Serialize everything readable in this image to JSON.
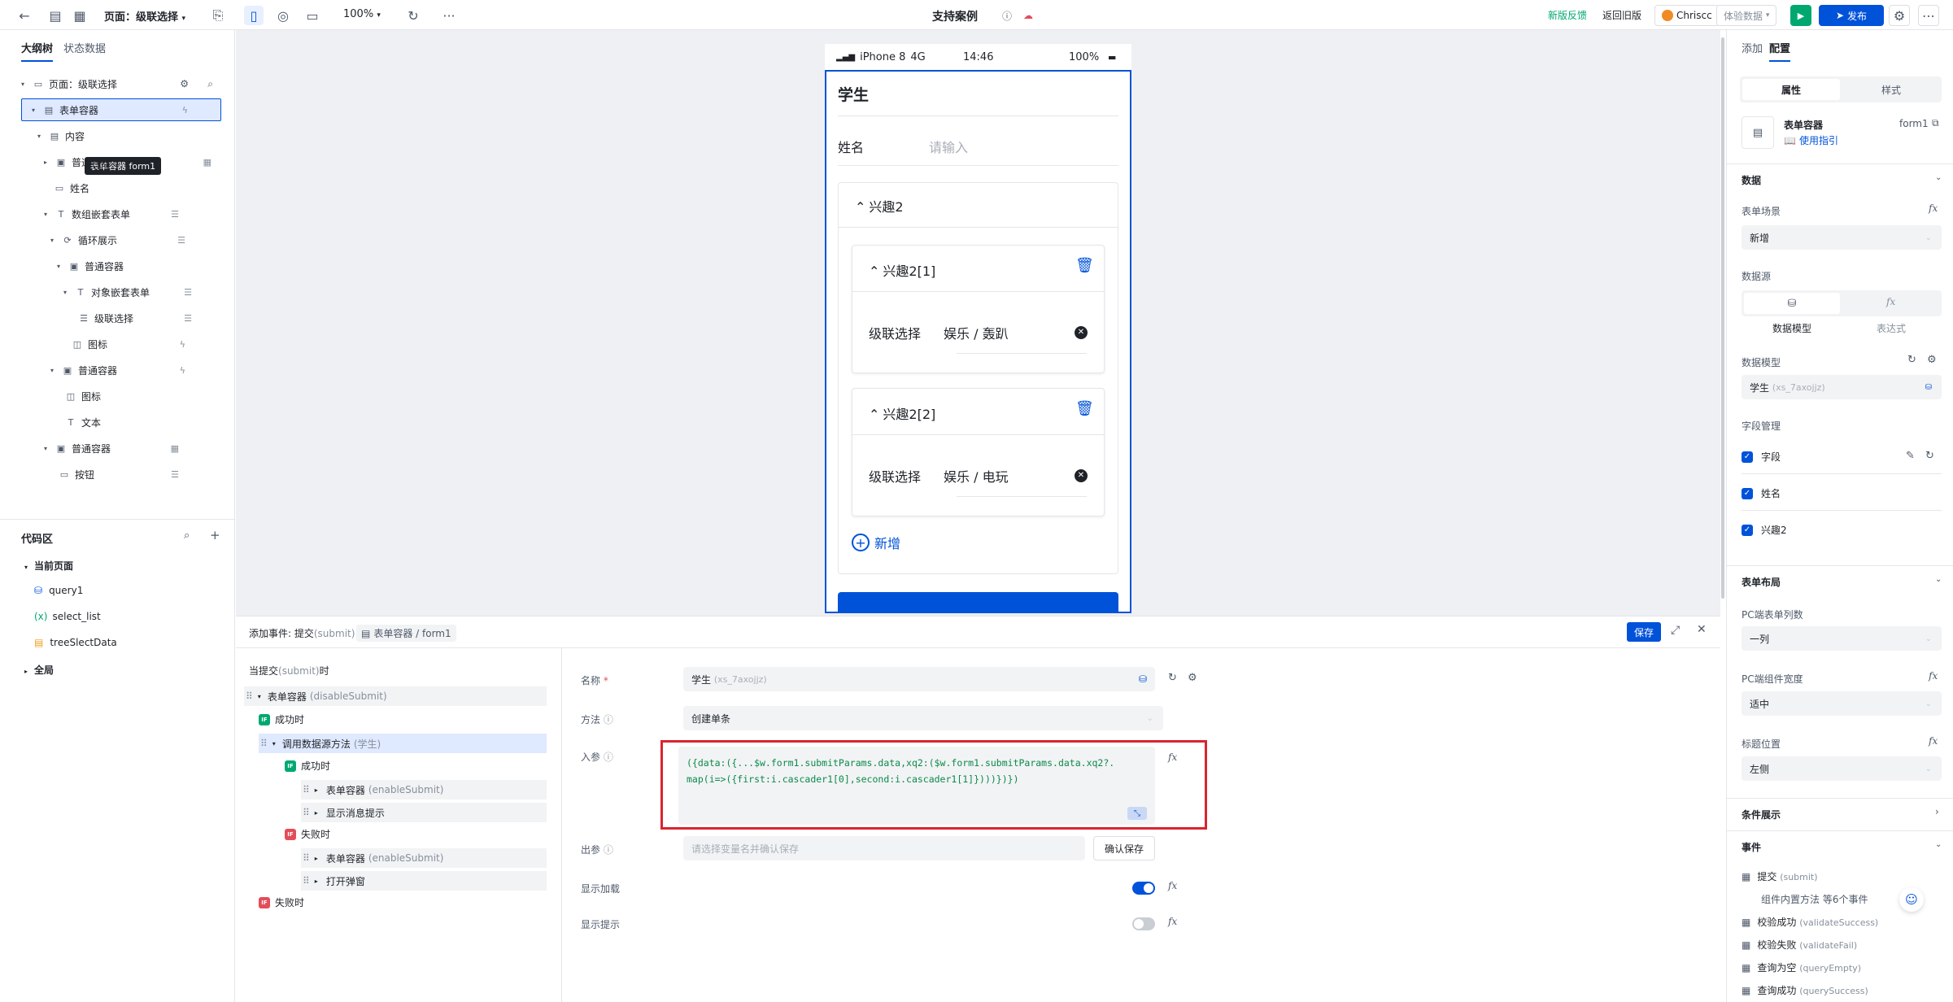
{
  "topbar": {
    "page_label": "页面：级联选择",
    "zoom": "100%",
    "title": "支持案例",
    "feedback": "新版反馈",
    "back_old": "返回旧版",
    "user": "Chriscc",
    "exp_data": "体验数据",
    "publish": "发布",
    "more": "···"
  },
  "left": {
    "tabs": [
      "大纲树",
      "状态数据"
    ],
    "tree": [
      {
        "label": "页面：级联选择"
      },
      {
        "label": "表单容器"
      },
      {
        "label": "内容"
      },
      {
        "label": "普通容器"
      },
      {
        "label": "姓名"
      },
      {
        "label": "数组嵌套表单"
      },
      {
        "label": "循环展示"
      },
      {
        "label": "普通容器"
      },
      {
        "label": "对象嵌套表单"
      },
      {
        "label": "级联选择"
      },
      {
        "label": "图标"
      },
      {
        "label": "普通容器"
      },
      {
        "label": "图标"
      },
      {
        "label": "文本"
      },
      {
        "label": "普通容器"
      },
      {
        "label": "按钮"
      }
    ],
    "tooltip": "表单容器 form1",
    "code_title": "代码区",
    "code_current": "当前页面",
    "code_items": [
      "query1",
      "select_list",
      "treeSlectData"
    ],
    "code_global": "全局"
  },
  "phone": {
    "model": "iPhone 8",
    "net": "4G",
    "time": "14:46",
    "battery": "100%",
    "form_title": "学生",
    "name_label": "姓名",
    "name_placeholder": "请输入",
    "group_title": "兴趣2",
    "items": [
      {
        "title": "兴趣2[1]",
        "label": "级联选择",
        "value": "娱乐 / 轰趴"
      },
      {
        "title": "兴趣2[2]",
        "label": "级联选择",
        "value": "娱乐 / 电玩"
      }
    ],
    "add_label": "新增"
  },
  "right": {
    "tabs": [
      "添加",
      "配置"
    ],
    "subtabs": [
      "属性",
      "样式"
    ],
    "comp_name": "表单容器",
    "comp_id": "form1",
    "guide": "使用指引",
    "data_section": "数据",
    "scene_label": "表单场景",
    "scene_value": "新增",
    "source_label": "数据源",
    "source_opts": [
      "数据模型",
      "表达式"
    ],
    "model_label": "数据模型",
    "model_value": "学生",
    "model_id": "(xs_7axojjz)",
    "fields_label": "字段管理",
    "fields": [
      "字段",
      "姓名",
      "兴趣2"
    ],
    "layout_section": "表单布局",
    "cols_label": "PC端表单列数",
    "cols_value": "一列",
    "width_label": "PC端组件宽度",
    "width_value": "适中",
    "titlepos_label": "标题位置",
    "titlepos_value": "左侧",
    "cond_section": "条件展示",
    "event_section": "事件",
    "events": [
      {
        "name": "提交",
        "code": "(submit)"
      },
      {
        "name": "校验成功",
        "code": "(validateSuccess)"
      },
      {
        "name": "校验失败",
        "code": "(validateFail)"
      },
      {
        "name": "查询为空",
        "code": "(queryEmpty)"
      },
      {
        "name": "查询成功",
        "code": "(querySuccess)"
      }
    ],
    "event_sub": "组件内置方法 等6个事件"
  },
  "event_panel": {
    "title": "添加事件: 提交",
    "title_code": "(submit)",
    "target": "表单容器 / form1",
    "save": "保存",
    "when": "当提交",
    "when_code": "(submit)",
    "when_suffix": "时",
    "flow": [
      {
        "label": "表单容器",
        "code": "(disableSubmit)"
      },
      {
        "label": "成功时",
        "tag": "IF"
      },
      {
        "label": "调用数据源方法",
        "code": "(学生)"
      },
      {
        "label": "成功时",
        "tag": "IF"
      },
      {
        "label": "表单容器",
        "code": "(enableSubmit)"
      },
      {
        "label": "显示消息提示",
        "code": ""
      },
      {
        "label": "失败时",
        "tag": "IF"
      },
      {
        "label": "表单容器",
        "code": "(enableSubmit)"
      },
      {
        "label": "打开弹窗",
        "code": ""
      },
      {
        "label": "失败时",
        "tag": "IF"
      }
    ],
    "name_label": "名称",
    "name_value": "学生",
    "name_id": "(xs_7axojjz)",
    "method_label": "方法",
    "method_value": "创建单条",
    "param_label": "入参",
    "param_code_line1": "({data:({...$w.form1.submitParams.data,xq2:($w.form1.submitParams.data.xq2?.",
    "param_code_line2": "map(i=>({first:i.cascader1[0],second:i.cascader1[1]})))})})",
    "out_label": "出参",
    "out_placeholder": "请选择变量名并确认保存",
    "confirm_save": "确认保存",
    "loading_label": "显示加载",
    "tip_label": "显示提示"
  },
  "colors": {
    "accent": "#0052d9",
    "highlight_border": "#d9252f",
    "success_green": "#00a870",
    "if_red": "#e34d59"
  }
}
